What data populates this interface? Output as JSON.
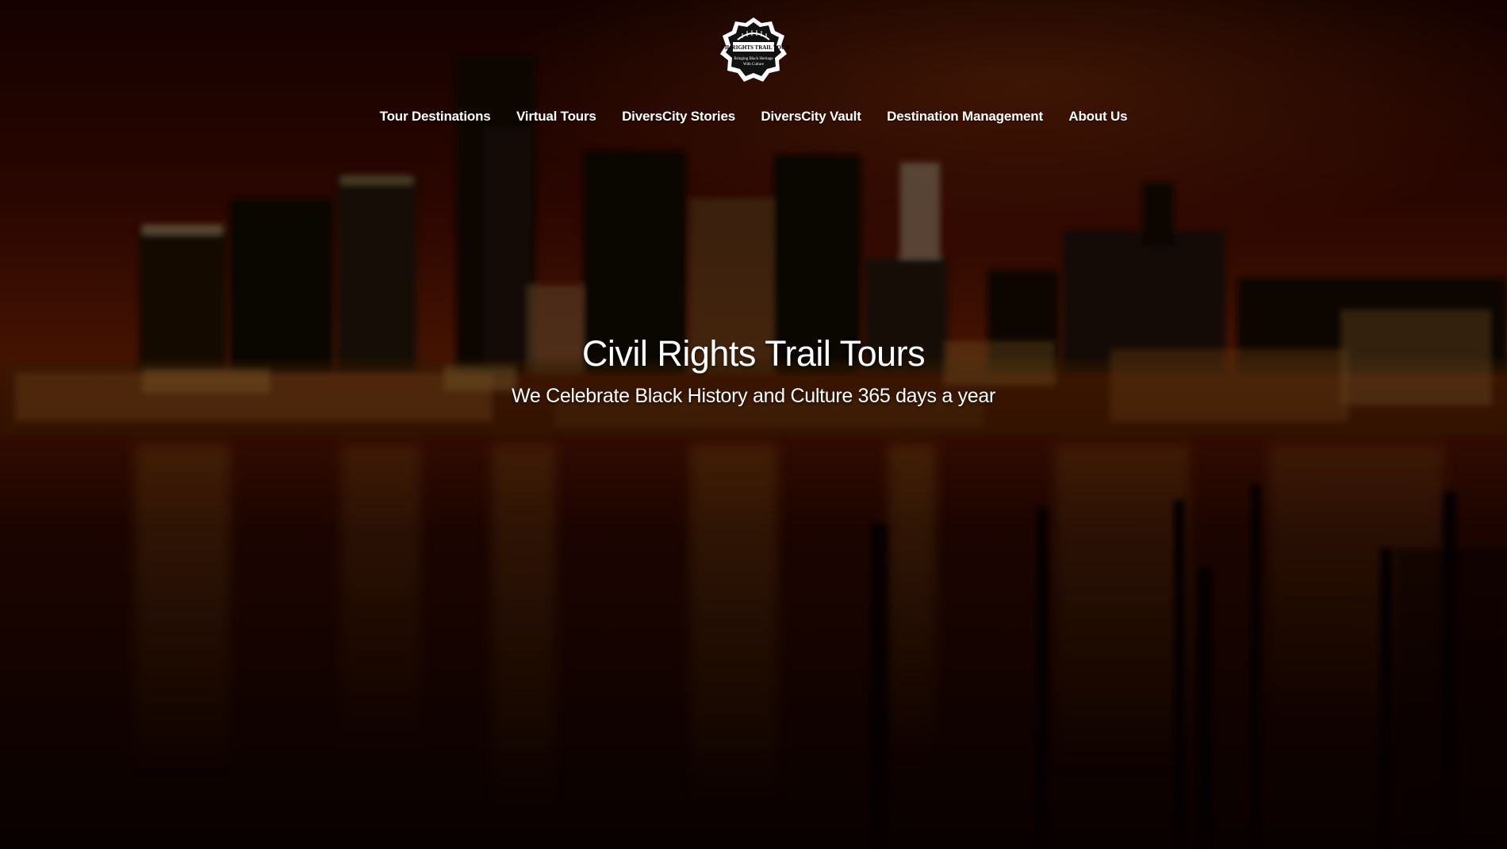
{
  "logo": {
    "text_line1": "CIVIL RIGHTS TRAIL TOURS",
    "text_line2": "Bringing Black Heritage",
    "text_line3": "With Culture",
    "icon": "badge-logo-icon"
  },
  "nav": {
    "items": [
      {
        "label": "Tour Destinations"
      },
      {
        "label": "Virtual Tours"
      },
      {
        "label": "DiversCity Stories"
      },
      {
        "label": "DiversCity Vault"
      },
      {
        "label": "Destination Management"
      },
      {
        "label": "About Us"
      }
    ]
  },
  "hero": {
    "title": "Civil Rights Trail Tours",
    "subtitle": "We Celebrate Black History and Culture 365 days a year"
  },
  "colors": {
    "sky_top": "#3a0602",
    "sky_mid": "#7a1a04",
    "water": "#1c0603",
    "text": "#ffffff"
  }
}
